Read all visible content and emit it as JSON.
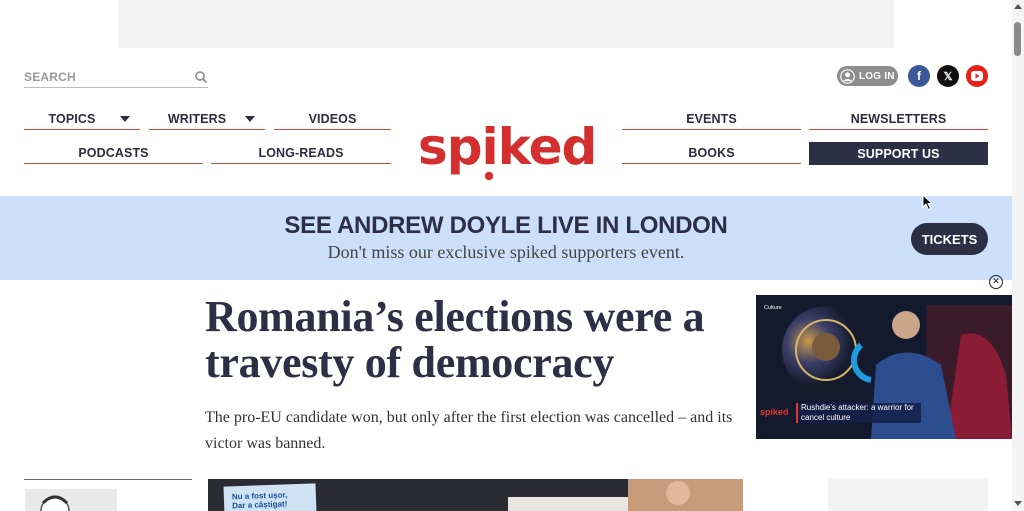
{
  "search": {
    "placeholder": "SEARCH"
  },
  "account": {
    "login_label": "LOG IN"
  },
  "social": {
    "facebook": "f",
    "x": "𝕏",
    "youtube_icon": "play-icon"
  },
  "nav": {
    "topics": "TOPICS",
    "writers": "WRITERS",
    "videos": "VIDEOS",
    "podcasts": "PODCASTS",
    "longreads": "LONG-READS",
    "events": "EVENTS",
    "newsletters": "NEWSLETTERS",
    "books": "BOOKS",
    "support": "SUPPORT US"
  },
  "logo": {
    "text": "spiked"
  },
  "banner": {
    "title": "SEE ANDREW DOYLE LIVE IN LONDON",
    "subtitle": "Don't miss our exclusive spiked supporters event.",
    "button": "TICKETS"
  },
  "article": {
    "headline": "Romania’s elections were a travesty of democracy",
    "standfirst": "The pro-EU candidate won, but only after the first election was cancelled – and its victor was banned."
  },
  "video": {
    "category": "Culture",
    "brand": "spiked",
    "caption": "Rushdie's attacker: a warrior for cancel culture"
  },
  "image_sign": {
    "line1": "Nu a fost ușor,",
    "line2": "Dar a câștigat!"
  },
  "colors": {
    "accent": "#d32f2f",
    "navy": "#2d2f45",
    "banner_bg": "#cce0fb"
  }
}
